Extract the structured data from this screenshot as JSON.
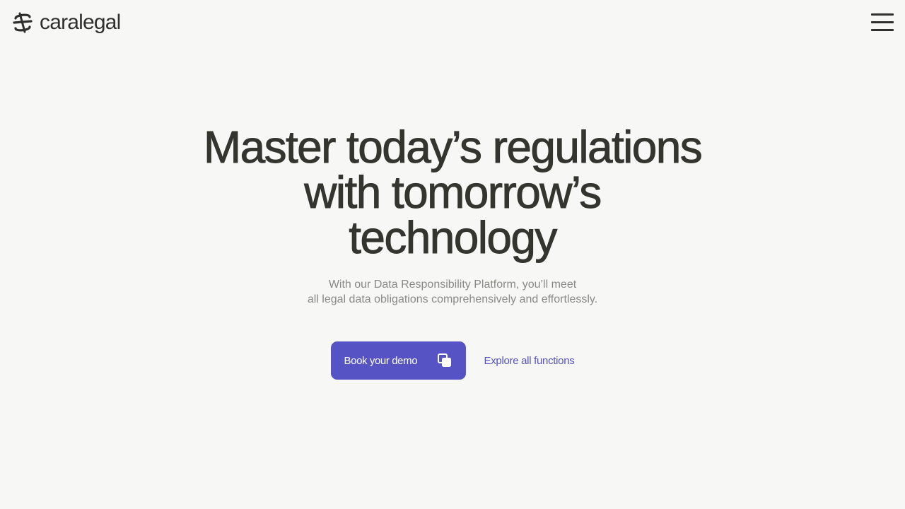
{
  "header": {
    "brand_name": "caralegal",
    "menu_icon": "hamburger-menu-icon"
  },
  "hero": {
    "title_lines": [
      "Master today’s regulations",
      "with tomorrow’s",
      "technology"
    ],
    "subtitle_lines": [
      "With our Data Responsibility Platform, you’ll meet",
      "all legal data obligations comprehensively and effortlessly."
    ]
  },
  "cta": {
    "primary_label": "Book your demo",
    "primary_icon": "copy-windows-icon",
    "secondary_label": "Explore all functions"
  },
  "colors": {
    "background": "#f7f7f5",
    "text": "#34352f",
    "muted": "#8a8a84",
    "accent": "#5653c4"
  }
}
